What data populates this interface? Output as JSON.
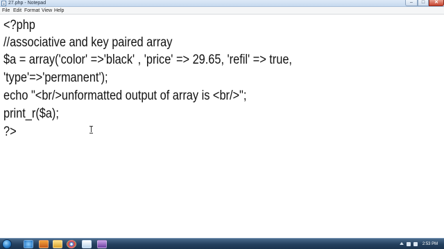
{
  "window": {
    "title": "27.php - Notepad",
    "controls": {
      "minimize": "–",
      "maximize": "□",
      "close": "✕"
    }
  },
  "menu": {
    "items": [
      "File",
      "Edit",
      "Format",
      "View",
      "Help"
    ]
  },
  "editor": {
    "lines": [
      "<?php",
      "//associative and key paired array",
      "$a = array('color' =>'black' , 'price' => 29.65, 'refil' => true,",
      "'type'=>'permanent');",
      "echo \"<br/>unformatted output of array is <br/>\";",
      "print_r($a);",
      "?>"
    ]
  },
  "taskbar": {
    "icons": [
      "windows-start-icon",
      "internet-explorer-icon",
      "media-player-icon",
      "folder-icon",
      "chrome-icon",
      "notepad-icon",
      "app-icon"
    ],
    "clock": "2:53 PM"
  }
}
